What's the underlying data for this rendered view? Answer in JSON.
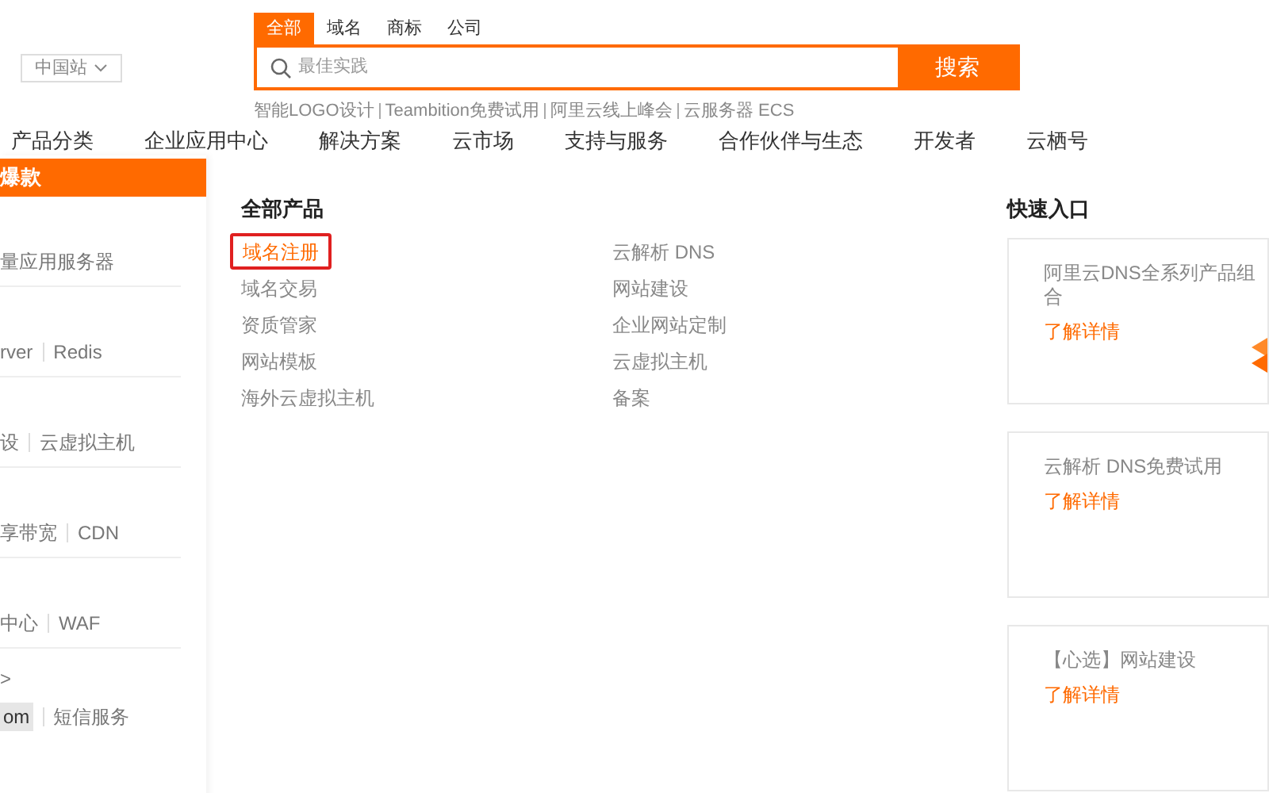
{
  "region_selector": {
    "label": "中国站"
  },
  "search": {
    "tabs": [
      {
        "label": "全部",
        "selected": true
      },
      {
        "label": "域名",
        "selected": false
      },
      {
        "label": "商标",
        "selected": false
      },
      {
        "label": "公司",
        "selected": false
      }
    ],
    "placeholder": "最佳实践",
    "button": "搜索",
    "hot_words": [
      "智能LOGO设计",
      "Teambition免费试用",
      "阿里云线上峰会",
      "云服务器 ECS"
    ]
  },
  "nav": [
    "产品分类",
    "企业应用中心",
    "解决方案",
    "云市场",
    "支持与服务",
    "合作伙伴与生态",
    "开发者",
    "云栖号"
  ],
  "sidebar": {
    "header": "爆款",
    "rows": [
      {
        "items": [
          {
            "label": "量应用服务器",
            "selected": false
          }
        ]
      },
      {
        "items": [
          {
            "label": "rver",
            "selected": false
          },
          {
            "label": "Redis",
            "selected": false
          }
        ]
      },
      {
        "items": [
          {
            "label": "设",
            "selected": false
          },
          {
            "label": "云虚拟主机",
            "selected": false
          }
        ]
      },
      {
        "items": [
          {
            "label": "享带宽",
            "selected": false
          },
          {
            "label": "CDN",
            "selected": false
          }
        ]
      },
      {
        "items": [
          {
            "label": "中心",
            "selected": false
          },
          {
            "label": "WAF",
            "selected": false
          }
        ]
      },
      {
        "items": [
          {
            "label": ">",
            "selected": false
          }
        ]
      },
      {
        "items": [
          {
            "label": "om",
            "selected": true
          },
          {
            "label": "短信服务",
            "selected": false
          }
        ]
      }
    ]
  },
  "products": {
    "title": "全部产品",
    "columns": [
      [
        {
          "label": "域名注册",
          "selected": true
        },
        {
          "label": "域名交易",
          "selected": false
        },
        {
          "label": "资质管家",
          "selected": false
        },
        {
          "label": "网站模板",
          "selected": false
        },
        {
          "label": "海外云虚拟主机",
          "selected": false
        }
      ],
      [
        {
          "label": "云解析 DNS",
          "selected": false
        },
        {
          "label": "网站建设",
          "selected": false
        },
        {
          "label": "企业网站定制",
          "selected": false
        },
        {
          "label": "云虚拟主机",
          "selected": false
        },
        {
          "label": "备案",
          "selected": false
        }
      ]
    ]
  },
  "quick_entry": {
    "title": "快速入口",
    "cards": [
      {
        "title": "阿里云DNS全系列产品组合",
        "link": "了解详情"
      },
      {
        "title": "云解析 DNS免费试用",
        "link": "了解详情"
      },
      {
        "title": "【心选】网站建设",
        "link": "了解详情"
      }
    ]
  }
}
